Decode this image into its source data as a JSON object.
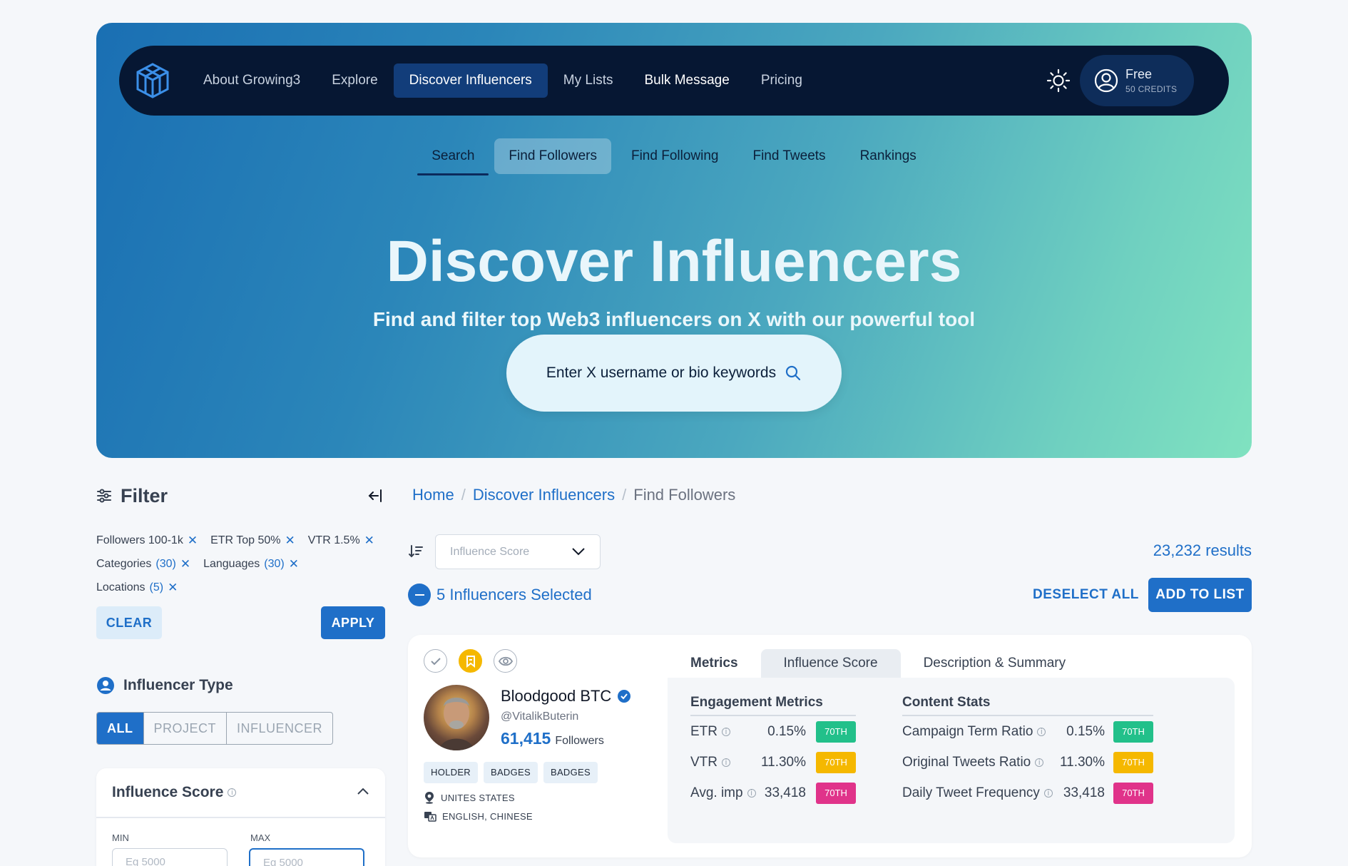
{
  "nav": {
    "items": [
      "About Growing3",
      "Explore",
      "Discover Influencers",
      "My Lists",
      "Bulk Message",
      "Pricing"
    ],
    "active": "Discover Influencers",
    "account": {
      "plan": "Free",
      "credits": "50 CREDITS"
    }
  },
  "subnav": [
    "Search",
    "Find Followers",
    "Find Following",
    "Find Tweets",
    "Rankings"
  ],
  "hero": {
    "title": "Discover Influencers",
    "subtitle": "Find and filter top Web3 influencers on X with our powerful tool",
    "search_placeholder": "Enter X username or bio keywords"
  },
  "filter": {
    "title": "Filter",
    "chips": {
      "followers": "Followers 100-1k",
      "etr": "ETR Top 50%",
      "vtr": "VTR 1.5%",
      "categories": "Categories",
      "categories_count": "(30)",
      "languages": "Languages",
      "languages_count": "(30)",
      "locations": "Locations",
      "locations_count": "(5)"
    },
    "clear": "CLEAR",
    "apply": "APPLY",
    "influencer_type": {
      "title": "Influencer Type",
      "options": [
        "ALL",
        "PROJECT",
        "INFLUENCER"
      ],
      "selected": "ALL"
    },
    "influence_score": {
      "title": "Influence Score",
      "min_label": "MIN",
      "max_label": "MAX",
      "min_placeholder": "Eg 5000",
      "max_placeholder": "Eg 5000"
    }
  },
  "breadcrumb": {
    "home": "Home",
    "section": "Discover Influencers",
    "current": "Find Followers"
  },
  "toolbar": {
    "sort_value": "Influence Score",
    "results": "23,232 results",
    "selected_text": "5 Influencers Selected",
    "deselect_all": "DESELECT ALL",
    "add_to_list": "ADD TO LIST"
  },
  "influencer": {
    "name": "Bloodgood BTC",
    "handle": "@VitalikButerin",
    "followers": "61,415",
    "followers_label": "Followers",
    "tags": [
      "HOLDER",
      "BADGES",
      "BADGES"
    ],
    "location": "UNITES STATES",
    "languages": "ENGLISH, CHINESE",
    "tabs": [
      "Metrics",
      "Influence Score",
      "Description & Summary"
    ],
    "active_tab": "Influence Score",
    "engagement": {
      "title": "Engagement Metrics",
      "rows": [
        {
          "label": "ETR",
          "value": "0.15%",
          "pct": "70TH",
          "color": "#22c08a"
        },
        {
          "label": "VTR",
          "value": "11.30%",
          "pct": "70TH",
          "color": "#f5b800"
        },
        {
          "label": "Avg. imp",
          "value": "33,418",
          "pct": "70TH",
          "color": "#e0338a"
        }
      ]
    },
    "content": {
      "title": "Content Stats",
      "rows": [
        {
          "label": "Campaign Term Ratio",
          "value": "0.15%",
          "pct": "70TH",
          "color": "#22c08a"
        },
        {
          "label": "Original Tweets Ratio",
          "value": "11.30%",
          "pct": "70TH",
          "color": "#f5b800"
        },
        {
          "label": "Daily Tweet Frequency",
          "value": "33,418",
          "pct": "70TH",
          "color": "#e0338a"
        }
      ]
    }
  }
}
